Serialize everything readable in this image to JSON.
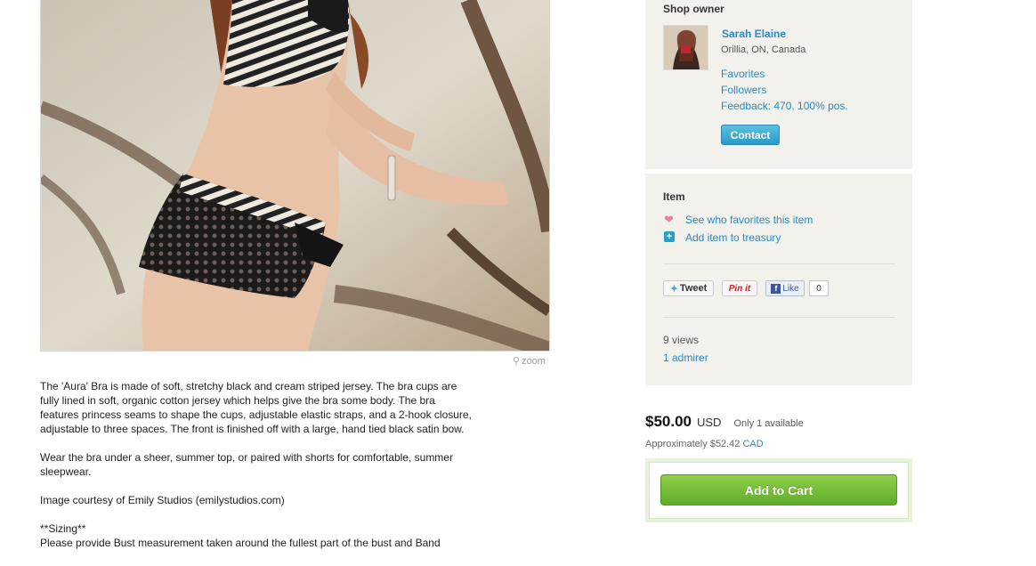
{
  "photo": {
    "zoom_label": "zoom"
  },
  "description": {
    "paragraphs": [
      "The 'Aura' Bra is made of soft, stretchy black and cream striped jersey. The bra cups are fully lined in soft, organic cotton jersey which helps give the bra some body. The bra features princess seams to shape the cups, adjustable elastic straps, and a 2-hook closure, adjustable to three spaces. The front is finished off with a large, hand tied black satin bow.",
      "Wear the bra under a sheer, summer top, or paired with shorts for comfortable, summer sleepwear.",
      "Image courtesy of Emily Studios (emilystudios.com)",
      "**Sizing**",
      "Please provide Bust measurement taken around the fullest part of the bust and Band"
    ]
  },
  "owner": {
    "heading": "Shop owner",
    "name": "Sarah Elaine",
    "location": "Orillia, ON, Canada",
    "links": [
      "Favorites",
      "Followers",
      "Feedback: 470, 100% pos."
    ],
    "contact_label": "Contact"
  },
  "item": {
    "heading": "Item",
    "favorites_link": "See who favorites this item",
    "treasury_link": "Add item to treasury",
    "tweet_label": "Tweet",
    "pin_label": "Pin it",
    "like_label": "Like",
    "like_count": "0",
    "views": "9 views",
    "admirers": "1 admirer"
  },
  "pricing": {
    "amount": "$50.00",
    "currency": "USD",
    "availability": "Only 1 available",
    "approx_prefix": "Approximately $52.42",
    "approx_currency": "CAD"
  },
  "cart": {
    "button_label": "Add to Cart"
  },
  "colors": {
    "link": "#2a8ac0",
    "panel_bg": "#f2f1ec",
    "cart_green": "#6bbd33",
    "contact_blue": "#3aa6d2"
  }
}
